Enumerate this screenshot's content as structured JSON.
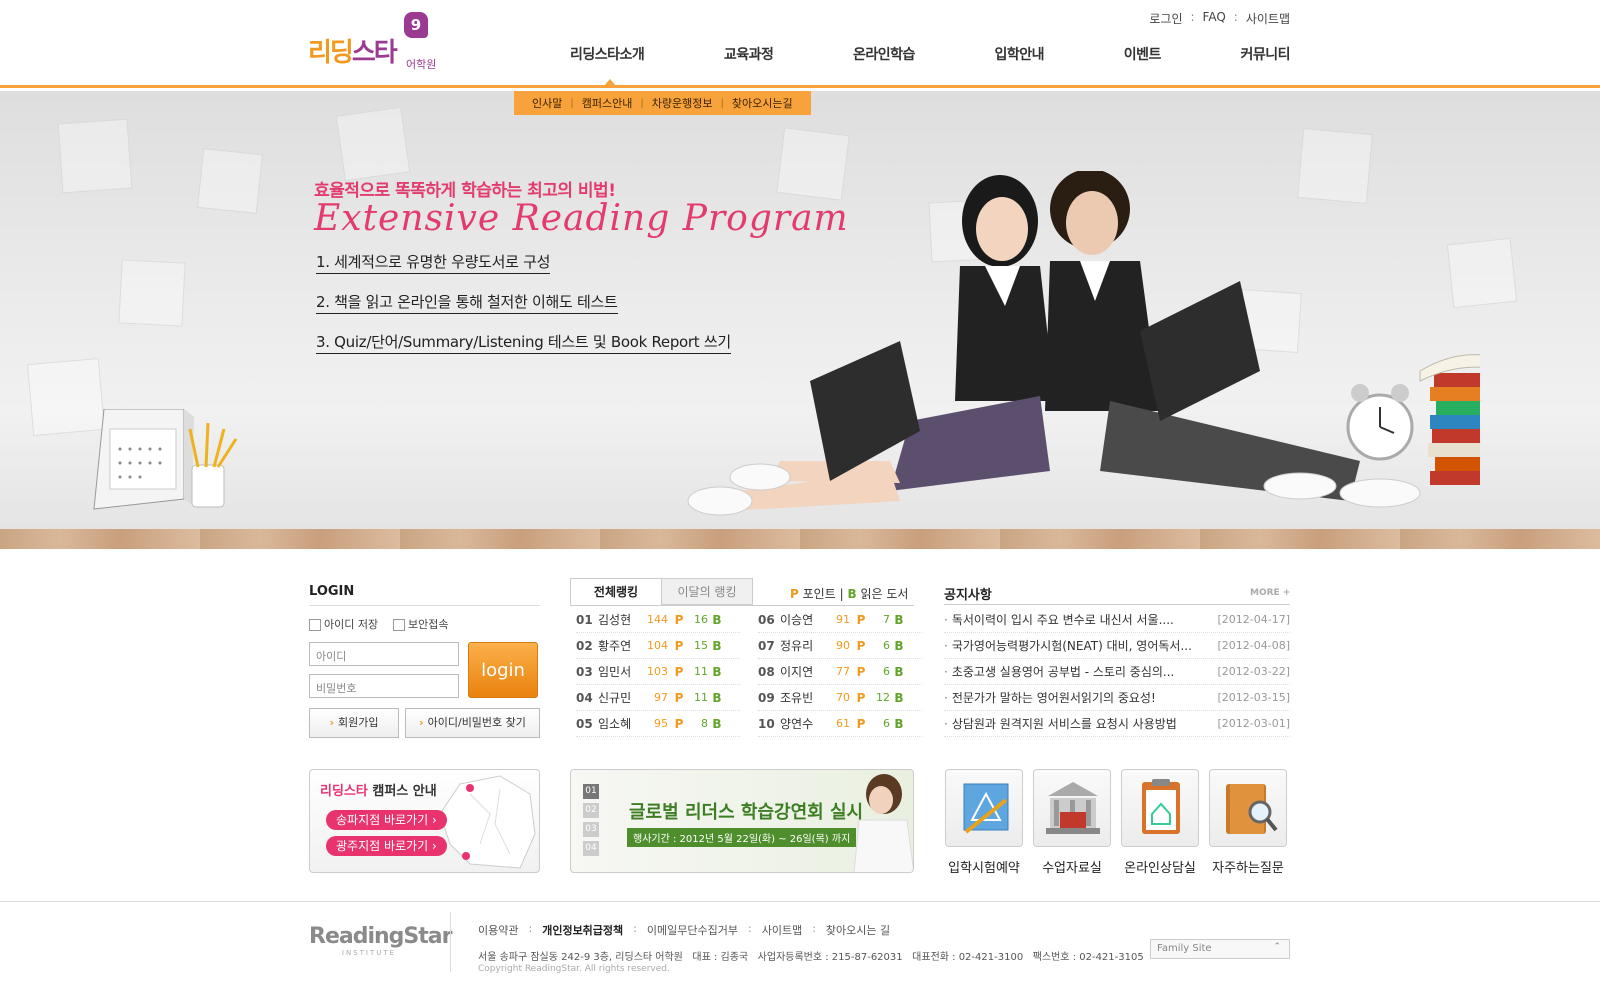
{
  "header": {
    "logo_text_a": "리딩",
    "logo_text_b": "스타",
    "logo_sub": "어학원",
    "logo_badge": "9",
    "util": [
      "로그인",
      "FAQ",
      "사이트맵"
    ],
    "gnb": [
      "리딩스타소개",
      "교육과정",
      "온라인학습",
      "입학안내",
      "이벤트",
      "커뮤니티"
    ],
    "subnav": [
      "인사말",
      "캠퍼스안내",
      "차량운행정보",
      "찾아오시는길"
    ]
  },
  "hero": {
    "subtitle": "효율적으로 똑똑하게 학습하는 최고의 비법!",
    "title": "Extensive Reading Program",
    "lines": [
      "1. 세계적으로 유명한 우량도서로 구성",
      "2. 책을 읽고 온라인을 통해 철저한 이해도 테스트",
      "3. Quiz/단어/Summary/Listening 테스트 및 Book Report 쓰기"
    ]
  },
  "login": {
    "title": "LOGIN",
    "save_id": "아이디 저장",
    "secure": "보안접속",
    "id_placeholder": "아이디",
    "pw_placeholder": "비밀번호",
    "login_button": "login",
    "join": "회원가입",
    "find": "아이디/비밀번호 찾기"
  },
  "ranking": {
    "tab_all": "전체랭킹",
    "tab_month": "이달의 랭킹",
    "legend_p": "P",
    "legend_p_label": "포인트",
    "legend_sep": "|",
    "legend_b": "B",
    "legend_b_label": "읽은 도서",
    "rows": [
      {
        "no": "01",
        "name": "김성현",
        "points": "144",
        "books": "16"
      },
      {
        "no": "02",
        "name": "황주연",
        "points": "104",
        "books": "15"
      },
      {
        "no": "03",
        "name": "임민서",
        "points": "103",
        "books": "11"
      },
      {
        "no": "04",
        "name": "신규민",
        "points": "97",
        "books": "11"
      },
      {
        "no": "05",
        "name": "임소혜",
        "points": "95",
        "books": "8"
      },
      {
        "no": "06",
        "name": "이승연",
        "points": "91",
        "books": "7"
      },
      {
        "no": "07",
        "name": "정유리",
        "points": "90",
        "books": "6"
      },
      {
        "no": "08",
        "name": "이지연",
        "points": "77",
        "books": "6"
      },
      {
        "no": "09",
        "name": "조유빈",
        "points": "70",
        "books": "12"
      },
      {
        "no": "10",
        "name": "양연수",
        "points": "61",
        "books": "6"
      }
    ]
  },
  "notice": {
    "title": "공지사항",
    "more": "MORE +",
    "items": [
      {
        "text": "독서이력이 입시 주요 변수로 내신서 서울....",
        "date": "[2012-04-17]"
      },
      {
        "text": "국가영어능력평가시험(NEAT) 대비, 영어독서...",
        "date": "[2012-04-08]"
      },
      {
        "text": "초중고생 실용영어 공부법 - 스토리 중심의...",
        "date": "[2012-03-22]"
      },
      {
        "text": "전문가가 말하는 영어원서읽기의 중요성!",
        "date": "[2012-03-15]"
      },
      {
        "text": "상담원과 원격지원 서비스를 요청시 사용방법",
        "date": "[2012-03-01]"
      }
    ]
  },
  "campus": {
    "title_a": "리딩스타",
    "title_b": "캠퍼스 안내",
    "songpa": "송파지점 바로가기",
    "gwangju": "광주지점 바로가기"
  },
  "banner": {
    "pages": [
      "01",
      "02",
      "03",
      "04"
    ],
    "title": "글로벌 리더스 학습강연회 실시",
    "period": "행사기간 : 2012년 5월 22일(화) ~ 26일(목) 까지"
  },
  "quick": [
    "입학시험예약",
    "수업자료실",
    "온라인상담실",
    "자주하는질문"
  ],
  "footer": {
    "logo": "ReadingStar",
    "logo_sub": "INSTITUTE",
    "links": [
      "이용약관",
      "개인정보취급정책",
      "이메일무단수집거부",
      "사이트맵",
      "찾아오시는 길"
    ],
    "address": "서울 송파구 잠실동 242-9 3층, 리딩스타 어학원   대표 : 김종국   사업자등록번호 : 215-87-62031   대표전화 : 02-421-3100   팩스번호 : 02-421-3105",
    "copyright": "Copyright ReadingStar. All rights reserved.",
    "family_site": "Family Site"
  }
}
